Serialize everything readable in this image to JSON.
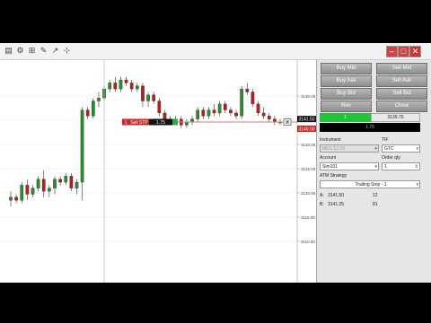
{
  "panel": {
    "buttons": [
      {
        "key": "buy_mkt",
        "label": "Buy Mkt"
      },
      {
        "key": "sell_mkt",
        "label": "Sell Mkt"
      },
      {
        "key": "buy_ask",
        "label": "Buy Ask"
      },
      {
        "key": "sell_ask",
        "label": "Sell Ask"
      },
      {
        "key": "buy_bid",
        "label": "Buy Bid"
      },
      {
        "key": "sell_bid",
        "label": "Sell Bid"
      },
      {
        "key": "rev",
        "label": "Rev"
      },
      {
        "key": "close",
        "label": "Close"
      }
    ],
    "position_qty": "1",
    "position_price": "3139.75",
    "pnl": "1.75",
    "instrument_label": "Instrument",
    "instrument_value": "MES 12-19",
    "tif_label": "TIF",
    "tif_value": "GTC",
    "account_label": "Account",
    "account_value": "Sim101",
    "order_qty_label": "Order qty",
    "order_qty_value": "1",
    "atm_label": "ATM Strategy",
    "atm_value": "Trailing Stop - 1",
    "row_a_label": "A:",
    "row_a_price": "3141.50",
    "row_a_size": "12",
    "row_b_label": "B:",
    "row_b_price": "3141.25",
    "row_b_size": "81"
  },
  "chart": {
    "order_label_qty": "1",
    "order_label_type": "Sell STP",
    "order_label_pnl": "1.75",
    "last_price_label": "3141.50",
    "stop_price_label": "3140.00",
    "price_axis_labels": [
      "3130.00",
      "3135.00",
      "3130.00",
      "3125.00",
      "3120.00",
      "3115.00",
      "3110.00"
    ],
    "colors": {
      "up": "#2e8b2e",
      "down": "#b32020",
      "stop": "#c62828",
      "position": "#2fa84a"
    }
  },
  "chart_data": {
    "type": "candlestick",
    "ylim": [
      3108,
      3142
    ],
    "candles": [
      {
        "o": 3120.5,
        "h": 3122.0,
        "l": 3119.5,
        "c": 3121.0
      },
      {
        "o": 3121.0,
        "h": 3121.5,
        "l": 3120.0,
        "c": 3120.5
      },
      {
        "o": 3120.5,
        "h": 3123.5,
        "l": 3120.0,
        "c": 3123.0
      },
      {
        "o": 3123.0,
        "h": 3124.0,
        "l": 3120.5,
        "c": 3121.5
      },
      {
        "o": 3121.5,
        "h": 3123.0,
        "l": 3121.0,
        "c": 3122.5
      },
      {
        "o": 3122.5,
        "h": 3124.5,
        "l": 3122.0,
        "c": 3124.0
      },
      {
        "o": 3124.0,
        "h": 3125.5,
        "l": 3121.0,
        "c": 3122.0
      },
      {
        "o": 3122.0,
        "h": 3123.0,
        "l": 3121.0,
        "c": 3122.5
      },
      {
        "o": 3122.5,
        "h": 3124.5,
        "l": 3121.5,
        "c": 3124.0
      },
      {
        "o": 3124.0,
        "h": 3124.5,
        "l": 3123.0,
        "c": 3123.5
      },
      {
        "o": 3123.5,
        "h": 3125.0,
        "l": 3123.0,
        "c": 3124.5
      },
      {
        "o": 3124.5,
        "h": 3125.0,
        "l": 3122.0,
        "c": 3122.5
      },
      {
        "o": 3122.5,
        "h": 3124.0,
        "l": 3121.5,
        "c": 3123.5
      },
      {
        "o": 3123.5,
        "h": 3136.0,
        "l": 3120.5,
        "c": 3135.5
      },
      {
        "o": 3135.5,
        "h": 3136.0,
        "l": 3134.0,
        "c": 3134.5
      },
      {
        "o": 3134.5,
        "h": 3137.5,
        "l": 3134.0,
        "c": 3137.0
      },
      {
        "o": 3137.0,
        "h": 3138.5,
        "l": 3136.0,
        "c": 3137.5
      },
      {
        "o": 3137.5,
        "h": 3139.5,
        "l": 3137.0,
        "c": 3139.0
      },
      {
        "o": 3139.0,
        "h": 3140.5,
        "l": 3138.5,
        "c": 3140.0
      },
      {
        "o": 3140.0,
        "h": 3141.0,
        "l": 3138.5,
        "c": 3139.0
      },
      {
        "o": 3139.0,
        "h": 3141.0,
        "l": 3138.5,
        "c": 3140.5
      },
      {
        "o": 3140.5,
        "h": 3141.0,
        "l": 3139.5,
        "c": 3140.0
      },
      {
        "o": 3140.0,
        "h": 3140.5,
        "l": 3138.5,
        "c": 3139.0
      },
      {
        "o": 3139.0,
        "h": 3140.0,
        "l": 3138.5,
        "c": 3139.5
      },
      {
        "o": 3139.5,
        "h": 3140.0,
        "l": 3136.0,
        "c": 3137.0
      },
      {
        "o": 3137.0,
        "h": 3138.5,
        "l": 3136.0,
        "c": 3138.0
      },
      {
        "o": 3138.0,
        "h": 3138.5,
        "l": 3136.5,
        "c": 3137.0
      },
      {
        "o": 3137.0,
        "h": 3137.5,
        "l": 3134.5,
        "c": 3135.0
      },
      {
        "o": 3135.0,
        "h": 3135.5,
        "l": 3133.5,
        "c": 3134.0
      },
      {
        "o": 3134.0,
        "h": 3134.5,
        "l": 3133.0,
        "c": 3133.5
      },
      {
        "o": 3133.5,
        "h": 3134.5,
        "l": 3133.0,
        "c": 3134.0
      },
      {
        "o": 3134.0,
        "h": 3134.5,
        "l": 3132.5,
        "c": 3133.0
      },
      {
        "o": 3133.0,
        "h": 3134.0,
        "l": 3132.5,
        "c": 3133.5
      },
      {
        "o": 3133.5,
        "h": 3134.5,
        "l": 3133.0,
        "c": 3134.0
      },
      {
        "o": 3134.0,
        "h": 3136.0,
        "l": 3133.5,
        "c": 3135.5
      },
      {
        "o": 3135.5,
        "h": 3136.0,
        "l": 3134.0,
        "c": 3134.5
      },
      {
        "o": 3134.5,
        "h": 3136.0,
        "l": 3134.0,
        "c": 3135.5
      },
      {
        "o": 3135.5,
        "h": 3136.5,
        "l": 3134.5,
        "c": 3135.0
      },
      {
        "o": 3135.0,
        "h": 3137.0,
        "l": 3134.5,
        "c": 3136.5
      },
      {
        "o": 3136.5,
        "h": 3137.0,
        "l": 3135.0,
        "c": 3135.5
      },
      {
        "o": 3135.5,
        "h": 3136.0,
        "l": 3134.5,
        "c": 3135.0
      },
      {
        "o": 3135.0,
        "h": 3135.5,
        "l": 3134.0,
        "c": 3134.5
      },
      {
        "o": 3134.5,
        "h": 3139.5,
        "l": 3134.0,
        "c": 3139.0
      },
      {
        "o": 3139.0,
        "h": 3140.0,
        "l": 3138.0,
        "c": 3138.5
      },
      {
        "o": 3138.5,
        "h": 3139.0,
        "l": 3136.0,
        "c": 3136.5
      },
      {
        "o": 3136.5,
        "h": 3137.0,
        "l": 3134.5,
        "c": 3135.0
      },
      {
        "o": 3135.0,
        "h": 3136.0,
        "l": 3134.0,
        "c": 3134.5
      },
      {
        "o": 3134.5,
        "h": 3135.0,
        "l": 3133.5,
        "c": 3134.0
      },
      {
        "o": 3134.0,
        "h": 3134.5,
        "l": 3133.0,
        "c": 3133.5
      },
      {
        "o": 3133.5,
        "h": 3134.0,
        "l": 3133.0,
        "c": 3133.5
      }
    ],
    "stop_price": 3133.5,
    "last_price": 3134.0,
    "cursor_bar_index": 17
  }
}
